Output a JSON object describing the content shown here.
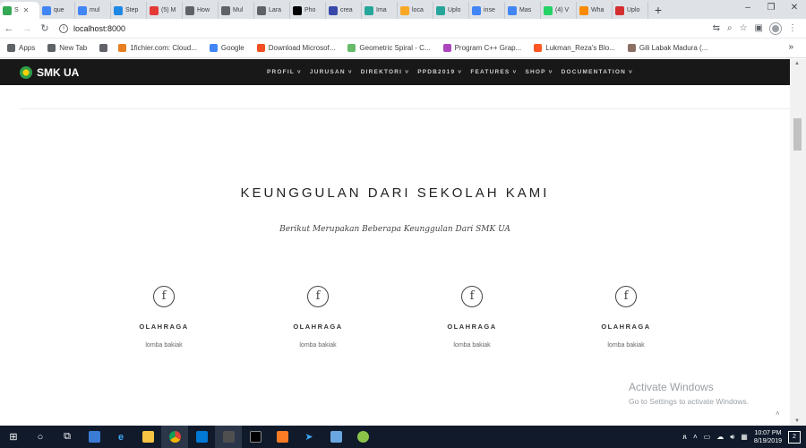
{
  "browser": {
    "tabs": [
      {
        "title": "S",
        "icon": "green-dot-icon",
        "color": "#34a853",
        "active": true
      },
      {
        "title": "que",
        "icon": "google-icon",
        "color": "#4285f4"
      },
      {
        "title": "mul",
        "icon": "google-icon",
        "color": "#4285f4"
      },
      {
        "title": "Step",
        "icon": "w-icon",
        "color": "#1e88e5"
      },
      {
        "title": "(5) M",
        "icon": "youtube-icon",
        "color": "#e53935"
      },
      {
        "title": "How",
        "icon": "send-icon",
        "color": "#5f6368"
      },
      {
        "title": "Mul",
        "icon": "send-icon",
        "color": "#5f6368"
      },
      {
        "title": "Lara",
        "icon": "page-icon",
        "color": "#5f6368"
      },
      {
        "title": "Pho",
        "icon": "medium-icon",
        "color": "#000000"
      },
      {
        "title": "crea",
        "icon": "code-icon",
        "color": "#3949ab"
      },
      {
        "title": "Ima",
        "icon": "image-icon",
        "color": "#26a69a"
      },
      {
        "title": "loca",
        "icon": "local-icon",
        "color": "#f9a825"
      },
      {
        "title": "Uplo",
        "icon": "image-icon",
        "color": "#26a69a"
      },
      {
        "title": "inse",
        "icon": "google-icon",
        "color": "#4285f4"
      },
      {
        "title": "Mas",
        "icon": "google-icon",
        "color": "#4285f4"
      },
      {
        "title": "(4) V",
        "icon": "whatsapp-icon",
        "color": "#25d366"
      },
      {
        "title": "Wha",
        "icon": "whatsapp-icon",
        "color": "#fb8c00"
      },
      {
        "title": "Uplo",
        "icon": "upload-icon",
        "color": "#d32f2f"
      }
    ],
    "url": "localhost:8000",
    "bookmarks": [
      {
        "label": "Apps",
        "icon": "apps-icon",
        "color": "#5f6368"
      },
      {
        "label": "New Tab",
        "icon": "globe-icon",
        "color": "#5f6368"
      },
      {
        "label": "",
        "icon": "globe-icon",
        "color": "#5f6368"
      },
      {
        "label": "1fichier.com: Cloud...",
        "icon": "fichier-icon",
        "color": "#e67e22"
      },
      {
        "label": "Google",
        "icon": "google-icon",
        "color": "#4285f4"
      },
      {
        "label": "Download Microsof...",
        "icon": "microsoft-icon",
        "color": "#f25022"
      },
      {
        "label": "Geometric Spiral - C...",
        "icon": "spiral-icon",
        "color": "#66bb6a"
      },
      {
        "label": "Program C++ Grap...",
        "icon": "program-icon",
        "color": "#ab47bc"
      },
      {
        "label": "Lukman_Reza's Blo...",
        "icon": "blogger-icon",
        "color": "#ff5722"
      },
      {
        "label": "Gili Labak Madura (...",
        "icon": "map-icon",
        "color": "#8d6e63"
      }
    ]
  },
  "site": {
    "logo_text": "SMK UA",
    "menu": [
      "PROFIL ˅",
      "JURUSAN ˅",
      "DIREKTORI ˅",
      "PPDB2019 ˅",
      "FEATURES ˅",
      "SHOP ˅",
      "DOCUMENTATION ˅"
    ],
    "heading": "KEUNGGULAN DARI SEKOLAH KAMI",
    "subheading": "Berikut Merupakan Beberapa Keunggulan Dari SMK UA",
    "features": [
      {
        "icon": "f",
        "title": "OLAHRAGA",
        "text": "lomba bakiak"
      },
      {
        "icon": "f",
        "title": "OLAHRAGA",
        "text": "lomba bakiak"
      },
      {
        "icon": "f",
        "title": "OLAHRAGA",
        "text": "lomba bakiak"
      },
      {
        "icon": "f",
        "title": "OLAHRAGA",
        "text": "lomba bakiak"
      }
    ]
  },
  "watermark": {
    "line1": "Activate Windows",
    "line2": "Go to Settings to activate Windows."
  },
  "taskbar": {
    "time": "10:07 PM",
    "date": "8/19/2019",
    "notifications": "2"
  }
}
